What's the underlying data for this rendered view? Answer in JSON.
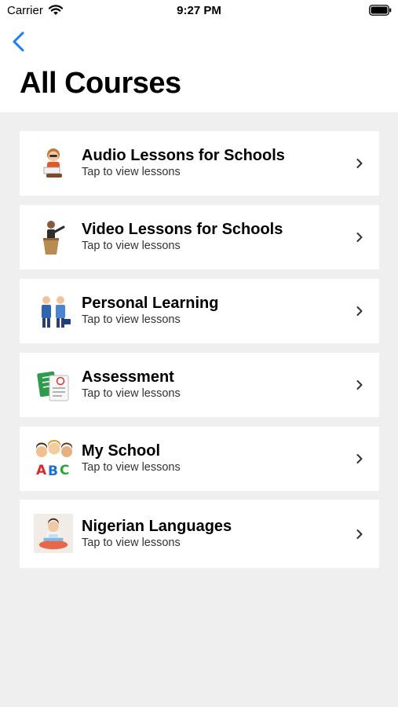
{
  "status_bar": {
    "carrier": "Carrier",
    "time": "9:27 PM"
  },
  "header": {
    "title": "All Courses",
    "back_icon": "chevron-left-icon",
    "accent_color": "#1a7cf5"
  },
  "courses": [
    {
      "title": "Audio Lessons for Schools",
      "subtitle": "Tap to view lessons",
      "icon": "reading-child-icon"
    },
    {
      "title": "Video Lessons for Schools",
      "subtitle": "Tap to view lessons",
      "icon": "teacher-podium-icon"
    },
    {
      "title": "Personal Learning",
      "subtitle": "Tap to view lessons",
      "icon": "business-people-icon"
    },
    {
      "title": "Assessment",
      "subtitle": "Tap to view lessons",
      "icon": "test-papers-icon"
    },
    {
      "title": "My School",
      "subtitle": "Tap to view lessons",
      "icon": "kids-abc-icon"
    },
    {
      "title": "Nigerian Languages",
      "subtitle": "Tap to view lessons",
      "icon": "child-laptop-icon"
    }
  ]
}
